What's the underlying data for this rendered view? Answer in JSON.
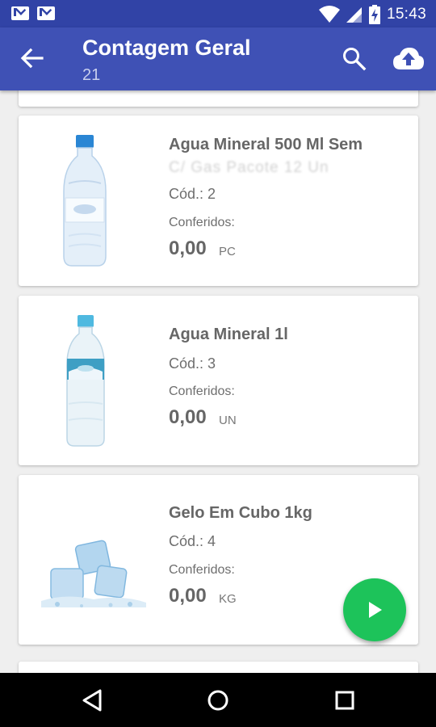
{
  "status_bar": {
    "time": "15:43",
    "icons": [
      "gmail-icon",
      "gmail-icon",
      "wifi-icon",
      "signal-icon",
      "battery-charging-icon"
    ]
  },
  "app_bar": {
    "title": "Contagem Geral",
    "subtitle": "21",
    "icons": [
      "back-arrow-icon",
      "search-icon",
      "cloud-upload-icon"
    ]
  },
  "products": [
    {
      "name": "Agua Mineral 500 Ml Sem",
      "name_line2": "C/ Gas Pacote 12 Un",
      "code": "Cód.: 2",
      "conferidos_label": "Conferidos:",
      "quantity": "0,00",
      "unit": "PC",
      "image": "water-bottle-500ml"
    },
    {
      "name": "Agua Mineral 1l",
      "code": "Cód.: 3",
      "conferidos_label": "Conferidos:",
      "quantity": "0,00",
      "unit": "UN",
      "image": "water-bottle-1l"
    },
    {
      "name": "Gelo Em Cubo 1kg",
      "code": "Cód.: 4",
      "conferidos_label": "Conferidos:",
      "quantity": "0,00",
      "unit": "KG",
      "image": "ice-cubes"
    }
  ],
  "fab": {
    "icon": "play-icon"
  },
  "nav_bar": {
    "icons": [
      "nav-back-icon",
      "nav-home-icon",
      "nav-recents-icon"
    ]
  },
  "colors": {
    "status_bar": "#3143a6",
    "app_bar": "#3f51b5",
    "fab": "#1dc35a",
    "text": "#666666",
    "background": "#efefef"
  }
}
